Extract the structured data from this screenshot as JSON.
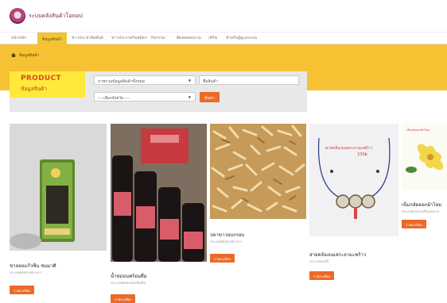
{
  "header": {
    "site_title": "ระบบคลังสินค้าโอทอป"
  },
  "nav": {
    "items": [
      {
        "label": "หน้าหลัก",
        "active": false
      },
      {
        "label": "ข้อมูลสินค้า",
        "active": true
      },
      {
        "label": "ข่าวประชาสัมพันธ์",
        "active": false
      },
      {
        "label": "ข่าวประกาศรับสมัคร",
        "active": false
      },
      {
        "label": "กิจกรรม",
        "active": false
      },
      {
        "label": "ติดต่อสอบถาม",
        "active": false
      },
      {
        "label": "เสิร์ช",
        "active": false
      },
      {
        "label": "สำหรับผู้ดูแลระบบ",
        "active": false
      }
    ]
  },
  "breadcrumb": {
    "label": "ข้อมูลสินค้า"
  },
  "search_panel": {
    "product_title": "PRODUCT",
    "product_subtitle": "ข้อมูลสินค้า",
    "category_select": "ภาพรวมข้อมูลสินค้าทั้งหมด",
    "province_select": "--- เลือกจังหวัด ---",
    "keyword_placeholder": "ชื่อสินค้า",
    "search_button": "ค้นหา"
  },
  "products": [
    {
      "name": "ชาลอยแก้วซีน ชนมาศิ",
      "category": "ประเภทผลิตภัณฑ์อาหาร",
      "button": "รายละเอียด"
    },
    {
      "name": "น้ำหม่อนพร้อมดื่ม",
      "category": "ประเภทผลิตภัณฑ์เครื่องดื่ม",
      "button": "รายละเอียด"
    },
    {
      "name": "ปลาขาวอบกรอบ",
      "category": "ประเภทผลิตภัณฑ์อาหาร",
      "button": "รายละเอียด"
    },
    {
      "name": "สายคล้องแมสกะลามะพร้าว",
      "category": "ประเภทของใช้",
      "button": "รายละเอียด"
    },
    {
      "name": "เข็มกลัดดอกผ้าไหม",
      "category": "ประเภทผ้าและเครื่องแต่งกาย",
      "button": "รายละเอียด"
    }
  ],
  "photo_texts": {
    "necklace_text": "สายคล้องแมสกะลามะพร้าว",
    "necklace_price": "100฿",
    "brooch_text": "เข็มกลัดดอกผ้าไหม"
  },
  "colors": {
    "accent": "#ec6a28",
    "band": "#f6c133",
    "product_box": "#ffe93a"
  }
}
